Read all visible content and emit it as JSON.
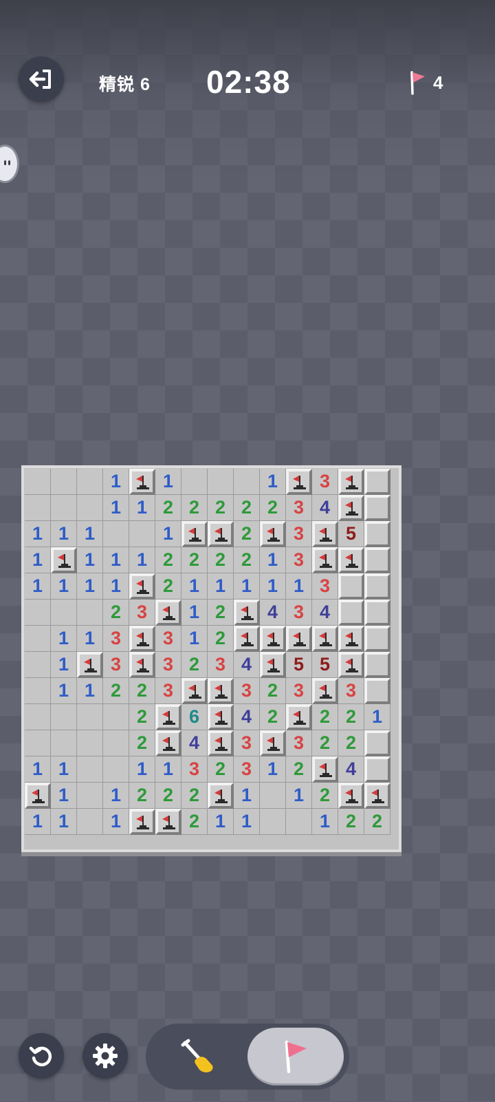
{
  "header": {
    "level": "精锐 6",
    "timer": "02:38",
    "flags_remaining": "4",
    "exit_icon": "exit-icon",
    "flag_icon": "flag-icon"
  },
  "board": {
    "columns": 14,
    "rows": 14,
    "legend": "cell codes: '' = revealed empty, '1'-'6' = revealed number, 'F' = flagged, '#' = covered",
    "grid": [
      [
        "",
        "",
        "",
        "1",
        "F",
        "1",
        "",
        "",
        "",
        "1",
        "F",
        "3",
        "F",
        "#"
      ],
      [
        "",
        "",
        "",
        "1",
        "1",
        "2",
        "2",
        "2",
        "2",
        "2",
        "3",
        "4",
        "F",
        "#"
      ],
      [
        "1",
        "1",
        "1",
        "",
        "",
        "1",
        "F",
        "F",
        "2",
        "F",
        "3",
        "F",
        "5",
        "#"
      ],
      [
        "1",
        "F",
        "1",
        "1",
        "1",
        "2",
        "2",
        "2",
        "2",
        "1",
        "3",
        "F",
        "F",
        "#"
      ],
      [
        "1",
        "1",
        "1",
        "1",
        "F",
        "2",
        "1",
        "1",
        "1",
        "1",
        "1",
        "3",
        "#",
        "#"
      ],
      [
        "",
        "",
        "",
        "2",
        "3",
        "F",
        "1",
        "2",
        "F",
        "4",
        "3",
        "4",
        "#",
        "#"
      ],
      [
        "",
        "1",
        "1",
        "3",
        "F",
        "3",
        "1",
        "2",
        "F",
        "F",
        "F",
        "F",
        "F",
        "#"
      ],
      [
        "",
        "1",
        "F",
        "3",
        "F",
        "3",
        "2",
        "3",
        "4",
        "F",
        "5",
        "5",
        "F",
        "#"
      ],
      [
        "",
        "1",
        "1",
        "2",
        "2",
        "3",
        "F",
        "F",
        "3",
        "2",
        "3",
        "F",
        "3",
        "#"
      ],
      [
        "",
        "",
        "",
        "",
        "2",
        "F",
        "6",
        "F",
        "4",
        "2",
        "F",
        "2",
        "2",
        "1"
      ],
      [
        "",
        "",
        "",
        "",
        "2",
        "F",
        "4",
        "F",
        "3",
        "F",
        "3",
        "2",
        "2",
        "#"
      ],
      [
        "1",
        "1",
        "",
        "",
        "1",
        "1",
        "3",
        "2",
        "3",
        "1",
        "2",
        "F",
        "4",
        "#"
      ],
      [
        "F",
        "1",
        "",
        "1",
        "2",
        "2",
        "2",
        "F",
        "1",
        "",
        "1",
        "2",
        "F",
        "F"
      ],
      [
        "1",
        "1",
        "",
        "1",
        "F",
        "F",
        "2",
        "1",
        "1",
        "",
        "",
        "1",
        "2",
        "2"
      ]
    ],
    "number_colors": {
      "1": "#2f5cc8",
      "2": "#2e9a3a",
      "3": "#d84343",
      "4": "#3f3f9a",
      "5": "#8e1c1c",
      "6": "#1f8a8a"
    },
    "flag_color": "#d63a3a"
  },
  "controls": {
    "restart_icon": "restart-icon",
    "settings_icon": "gear-icon",
    "dig_icon": "shovel-icon",
    "flag_mode_icon": "flag-icon",
    "active_mode": "flag"
  }
}
